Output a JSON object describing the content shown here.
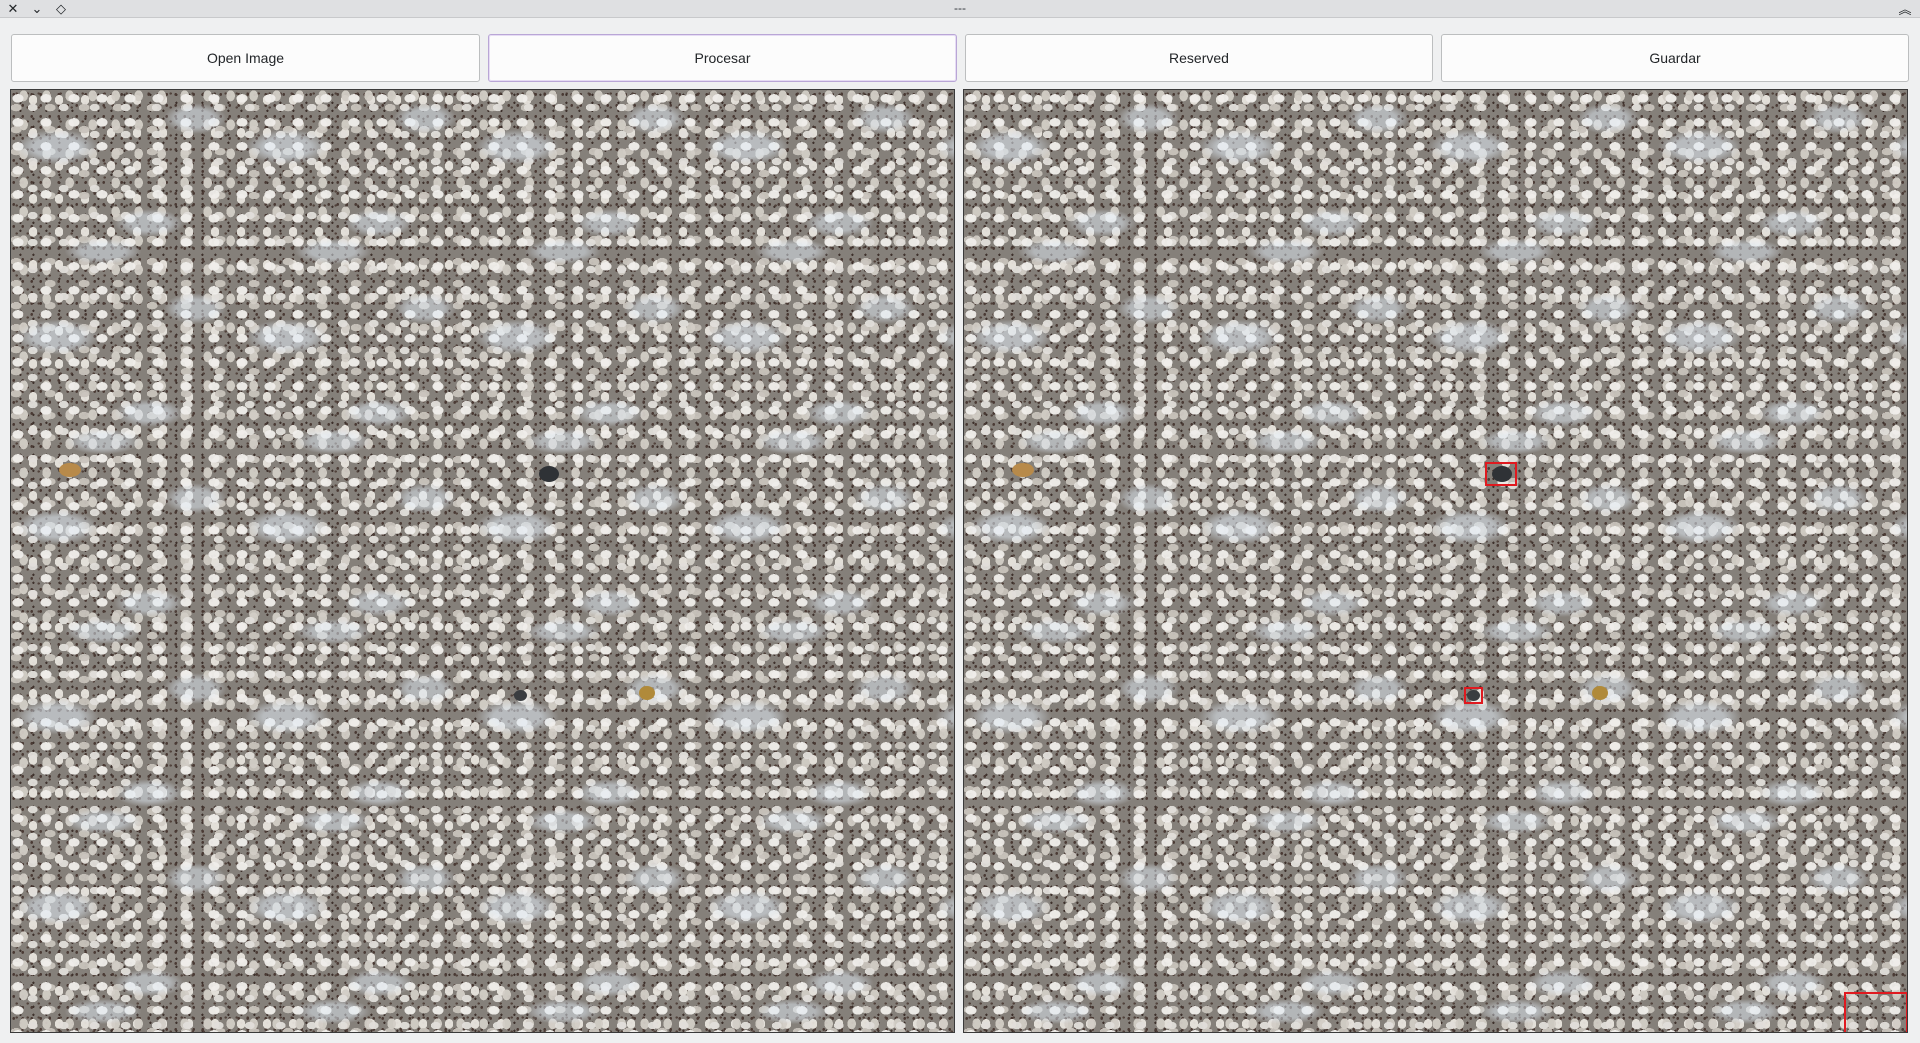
{
  "window": {
    "title": "---",
    "controls": {
      "close_icon": "close-icon",
      "minimize_icon": "chevron-down-icon",
      "pin_icon": "diamond-icon",
      "collapse_icon": "double-chevron-up-icon"
    }
  },
  "toolbar": {
    "open_label": "Open Image",
    "process_label": "Procesar",
    "reserved_label": "Reserved",
    "save_label": "Guardar"
  },
  "panes": {
    "original": {
      "description_icon": "image"
    },
    "processed": {
      "detections_count": 3,
      "detection_color": "#e0191f"
    }
  }
}
